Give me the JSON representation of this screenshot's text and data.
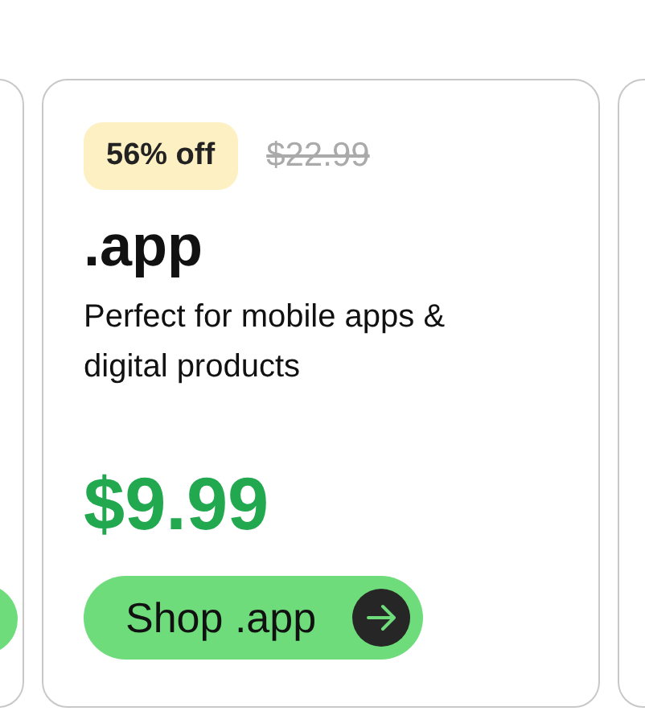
{
  "card": {
    "discount": "56% off",
    "original_price": "$22.99",
    "title": ".app",
    "description": "Perfect for mobile apps & digital products",
    "price": "$9.99",
    "button": "Shop .app"
  }
}
